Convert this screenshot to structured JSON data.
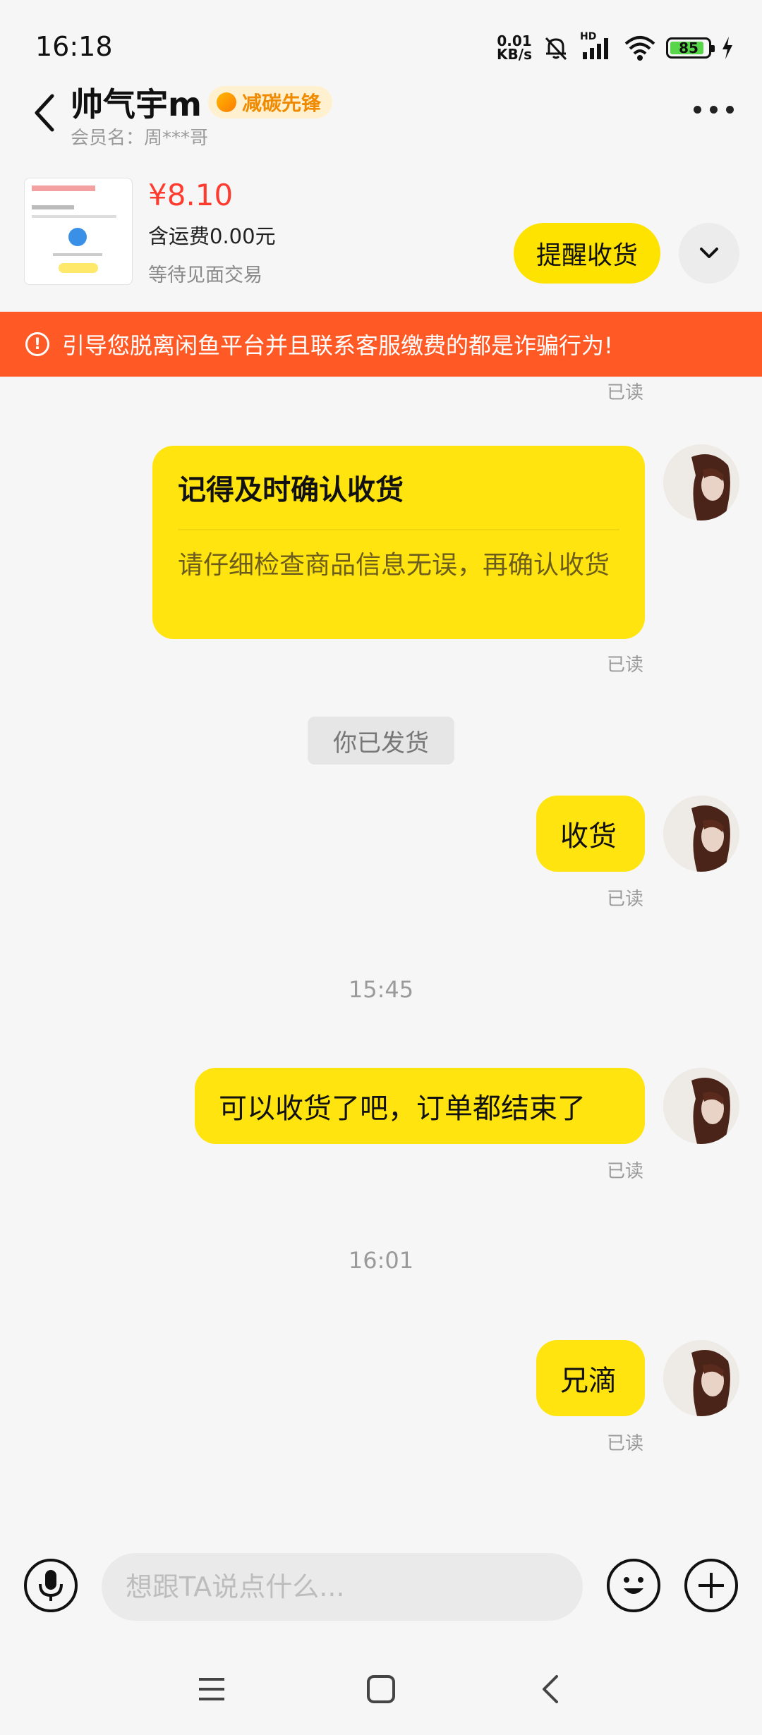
{
  "status_bar": {
    "time": "16:18",
    "net_speed_value": "0.01",
    "net_speed_unit": "KB/s",
    "signal_label": "HD",
    "battery": "85"
  },
  "header": {
    "name": "帅气宇m",
    "badge": "减碳先锋",
    "member": "会员名：周***哥"
  },
  "product": {
    "price": "¥8.10",
    "shipping": "含运费0.00元",
    "status": "等待见面交易",
    "remind_label": "提醒收货"
  },
  "warning": {
    "text": "引导您脱离闲鱼平台并且联系客服缴费的都是诈骗行为!"
  },
  "chat": {
    "read_label": "已读",
    "card": {
      "title": "记得及时确认收货",
      "body": "请仔细检查商品信息无误，再确认收货"
    },
    "system": "你已发货",
    "msg1": "收货",
    "time1": "15:45",
    "msg2": "可以收货了吧，订单都结束了",
    "time2": "16:01",
    "msg3": "兄滴"
  },
  "input": {
    "placeholder": "想跟TA说点什么..."
  },
  "colors": {
    "accent_yellow": "#ffe40f",
    "warning_orange": "#ff5a26",
    "price_red": "#ff3b30"
  }
}
